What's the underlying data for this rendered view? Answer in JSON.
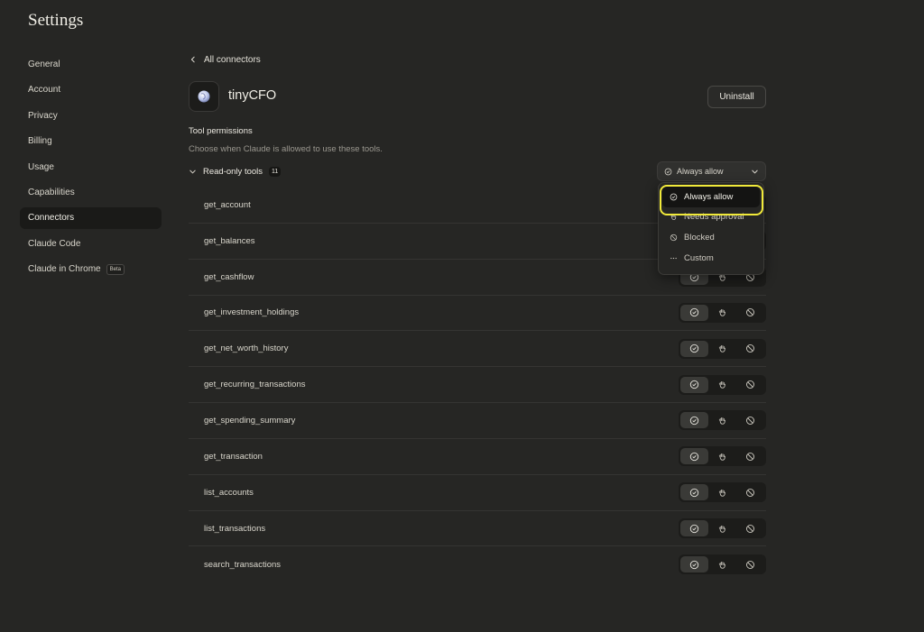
{
  "page": {
    "title": "Settings"
  },
  "sidebar": {
    "items": [
      {
        "label": "General"
      },
      {
        "label": "Account"
      },
      {
        "label": "Privacy"
      },
      {
        "label": "Billing"
      },
      {
        "label": "Usage"
      },
      {
        "label": "Capabilities"
      },
      {
        "label": "Connectors",
        "active": true
      },
      {
        "label": "Claude Code"
      },
      {
        "label": "Claude in Chrome",
        "badge": "Beta"
      }
    ]
  },
  "connector": {
    "back_label": "All connectors",
    "name": "tinyCFO",
    "uninstall_label": "Uninstall",
    "icon": "globe-icon"
  },
  "permissions": {
    "title": "Tool permissions",
    "subtitle": "Choose when Claude is allowed to use these tools.",
    "group": {
      "label": "Read-only tools",
      "count": "11",
      "selected": "Always allow"
    },
    "tools": [
      {
        "name": "get_account",
        "state": "always"
      },
      {
        "name": "get_balances",
        "state": "always"
      },
      {
        "name": "get_cashflow",
        "state": "always"
      },
      {
        "name": "get_investment_holdings",
        "state": "always"
      },
      {
        "name": "get_net_worth_history",
        "state": "always"
      },
      {
        "name": "get_recurring_transactions",
        "state": "always"
      },
      {
        "name": "get_spending_summary",
        "state": "always"
      },
      {
        "name": "get_transaction",
        "state": "always"
      },
      {
        "name": "list_accounts",
        "state": "always"
      },
      {
        "name": "list_transactions",
        "state": "always"
      },
      {
        "name": "search_transactions",
        "state": "always"
      }
    ],
    "dropdown_options": [
      {
        "label": "Always allow",
        "icon": "check-circle-icon",
        "selected": true
      },
      {
        "label": "Needs approval",
        "icon": "hand-icon"
      },
      {
        "label": "Blocked",
        "icon": "blocked-icon"
      },
      {
        "label": "Custom",
        "icon": "ellipsis-icon"
      }
    ]
  },
  "colors": {
    "background": "#262624",
    "highlight": "#f1ea3a"
  }
}
